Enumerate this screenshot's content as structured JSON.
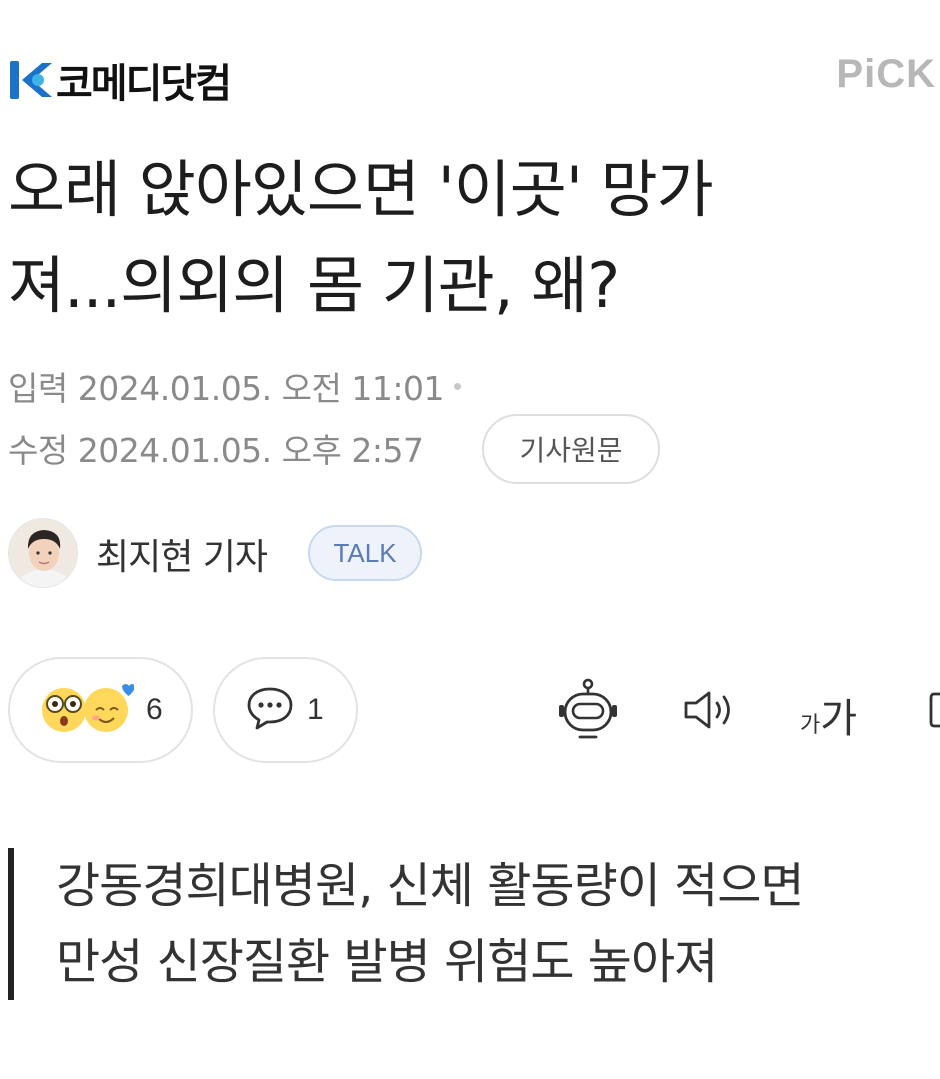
{
  "header": {
    "brand_name": "코메디닷컴",
    "brand_color": "#1a73c8",
    "pick_label": "PiCK"
  },
  "article": {
    "title_line1": "오래 앉아있으면 '이곳' 망가",
    "title_line2": "져...의외의 몸 기관, 왜?",
    "published_label": "입력",
    "published": "2024.01.05. 오전 11:01",
    "modified_label": "수정",
    "modified": "2024.01.05. 오후 2:57",
    "original_button": "기사원문",
    "reporter": "최지현 기자",
    "talk_label": "TALK"
  },
  "actions": {
    "reaction_count": "6",
    "comment_count": "1",
    "tools": [
      "robot-summary-icon",
      "speaker-icon",
      "font-size-icon"
    ],
    "font_size_small": "가",
    "font_size_large": "가"
  },
  "summary": {
    "line1": "강동경희대병원, 신체 활동량이 적으면",
    "line2": "만성 신장질환 발병 위험도 높아져"
  }
}
